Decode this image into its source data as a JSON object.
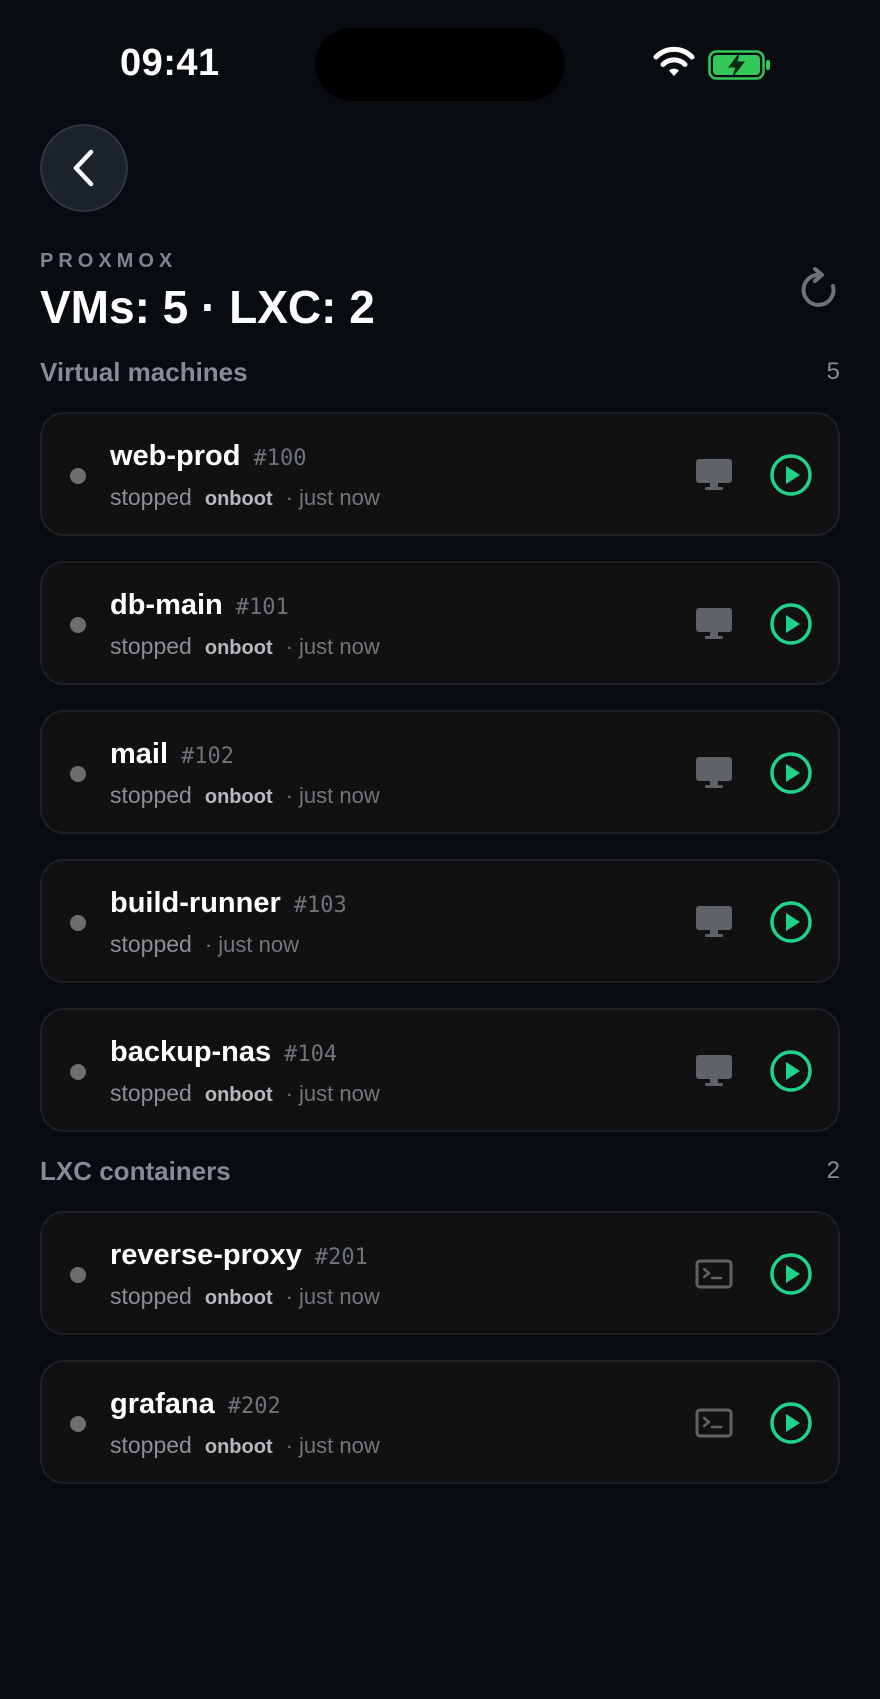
{
  "status": {
    "time": "09:41"
  },
  "header": {
    "eyebrow": "PROXMOX",
    "title": "VMs: 5 · LXC: 2"
  },
  "sections": {
    "vms": {
      "title": "Virtual machines",
      "count": "5"
    },
    "lxc": {
      "title": "LXC containers",
      "count": "2"
    }
  },
  "vms": [
    {
      "name": "web-prod",
      "id": "#100",
      "state": "stopped",
      "onboot": "onboot",
      "ago": "· just now",
      "console": "monitor-icon"
    },
    {
      "name": "db-main",
      "id": "#101",
      "state": "stopped",
      "onboot": "onboot",
      "ago": "· just now",
      "console": "monitor-icon"
    },
    {
      "name": "mail",
      "id": "#102",
      "state": "stopped",
      "onboot": "onboot",
      "ago": "· just now",
      "console": "monitor-icon"
    },
    {
      "name": "build-runner",
      "id": "#103",
      "state": "stopped",
      "onboot": "",
      "ago": "· just now",
      "console": "monitor-icon"
    },
    {
      "name": "backup-nas",
      "id": "#104",
      "state": "stopped",
      "onboot": "onboot",
      "ago": "· just now",
      "console": "monitor-icon"
    }
  ],
  "lxc": [
    {
      "name": "reverse-proxy",
      "id": "#201",
      "state": "stopped",
      "onboot": "onboot",
      "ago": "· just now",
      "console": "terminal-icon"
    },
    {
      "name": "grafana",
      "id": "#202",
      "state": "stopped",
      "onboot": "onboot",
      "ago": "· just now",
      "console": "terminal-icon"
    }
  ],
  "colors": {
    "background": "#080b0f",
    "card": "#111112",
    "accent_green": "#1fd38a",
    "battery_green": "#34c759",
    "status_dot": "#6b6d70"
  }
}
